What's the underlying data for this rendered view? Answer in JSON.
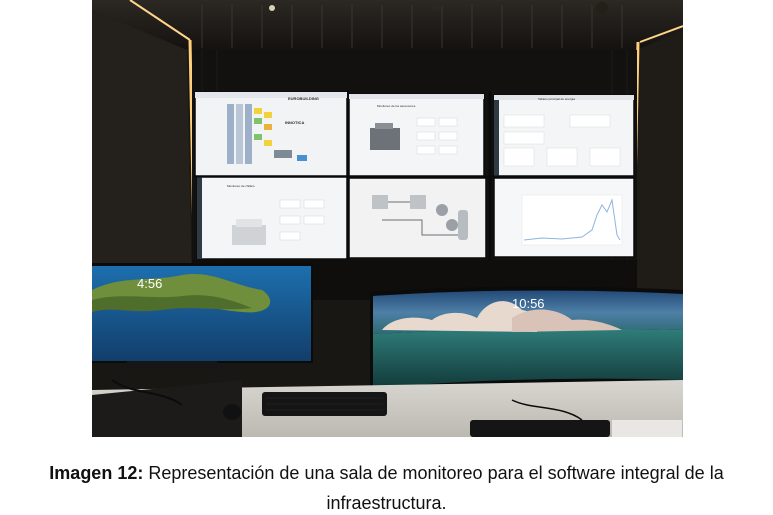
{
  "photo": {
    "left_clock": "4:56",
    "right_clock": "10:56",
    "brands": [
      "INNOTICA",
      "EUROBUILDING"
    ],
    "panel_titles": [
      "Monitoreo de los ascensores",
      "Tablero principal de energía",
      "Monitoreo de chillers"
    ]
  },
  "caption": {
    "bold": "Imagen 12:",
    "text": " Representación de una sala de monitoreo para el software integral de la",
    "line2": "infraestructura."
  }
}
